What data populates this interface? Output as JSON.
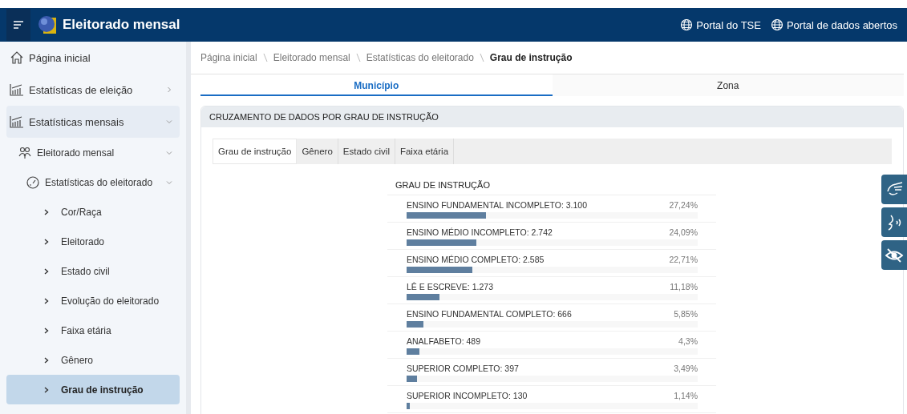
{
  "header": {
    "title": "Eleitorado mensal",
    "links": [
      "Portal do TSE",
      "Portal de dados abertos"
    ]
  },
  "sidebar": {
    "items": [
      {
        "label": "Página inicial",
        "selected": false
      },
      {
        "label": "Estatísticas de eleição",
        "expanded": false,
        "selected": false
      },
      {
        "label": "Estatísticas mensais",
        "expanded": true,
        "selected": true,
        "children": [
          {
            "label": "Eleitorado mensal",
            "expanded": true,
            "selected": false,
            "children": [
              {
                "label": "Estatísticas do eleitorado",
                "expanded": true,
                "selected": false,
                "children": [
                  {
                    "label": "Cor/Raça",
                    "selected": false
                  },
                  {
                    "label": "Eleitorado",
                    "selected": false
                  },
                  {
                    "label": "Estado civil",
                    "selected": false
                  },
                  {
                    "label": "Evolução do eleitorado",
                    "selected": false
                  },
                  {
                    "label": "Faixa etária",
                    "selected": false
                  },
                  {
                    "label": "Gênero",
                    "selected": false
                  },
                  {
                    "label": "Grau de instrução",
                    "selected": true
                  }
                ]
              }
            ]
          }
        ]
      }
    ]
  },
  "breadcrumb": [
    "Página inicial",
    "Eleitorado mensal",
    "Estatísticas do eleitorado",
    "Grau de instrução"
  ],
  "tabs": [
    {
      "label": "Município",
      "selected": true
    },
    {
      "label": "Zona",
      "selected": false
    }
  ],
  "card": {
    "title": "CRUZAMENTO DE DADOS POR GRAU DE INSTRUÇÃO",
    "tabs": [
      {
        "label": "Grau de instrução",
        "selected": true
      },
      {
        "label": "Gênero",
        "selected": false
      },
      {
        "label": "Estado civil",
        "selected": false
      },
      {
        "label": "Faixa etária",
        "selected": false
      }
    ],
    "panel_title": "GRAU DE INSTRUÇÃO",
    "rows": [
      {
        "label": "ENSINO FUNDAMENTAL INCOMPLETO: 3.100",
        "percent": "27,24%",
        "level": 0.2724
      },
      {
        "label": "ENSINO MÉDIO INCOMPLETO: 2.742",
        "percent": "24,09%",
        "level": 0.2409
      },
      {
        "label": "ENSINO MÉDIO COMPLETO: 2.585",
        "percent": "22,71%",
        "level": 0.2271
      },
      {
        "label": "LÊ E ESCREVE: 1.273",
        "percent": "11,18%",
        "level": 0.1118
      },
      {
        "label": "ENSINO FUNDAMENTAL COMPLETO: 666",
        "percent": "5,85%",
        "level": 0.0585
      },
      {
        "label": "ANALFABETO: 489",
        "percent": "4,3%",
        "level": 0.043
      },
      {
        "label": "SUPERIOR COMPLETO: 397",
        "percent": "3,49%",
        "level": 0.0349
      },
      {
        "label": "SUPERIOR INCOMPLETO: 130",
        "percent": "1,14%",
        "level": 0.0114
      }
    ]
  },
  "accessibility_buttons": [
    {
      "kind": "sign"
    },
    {
      "kind": "voice"
    },
    {
      "kind": "contrast"
    }
  ]
}
